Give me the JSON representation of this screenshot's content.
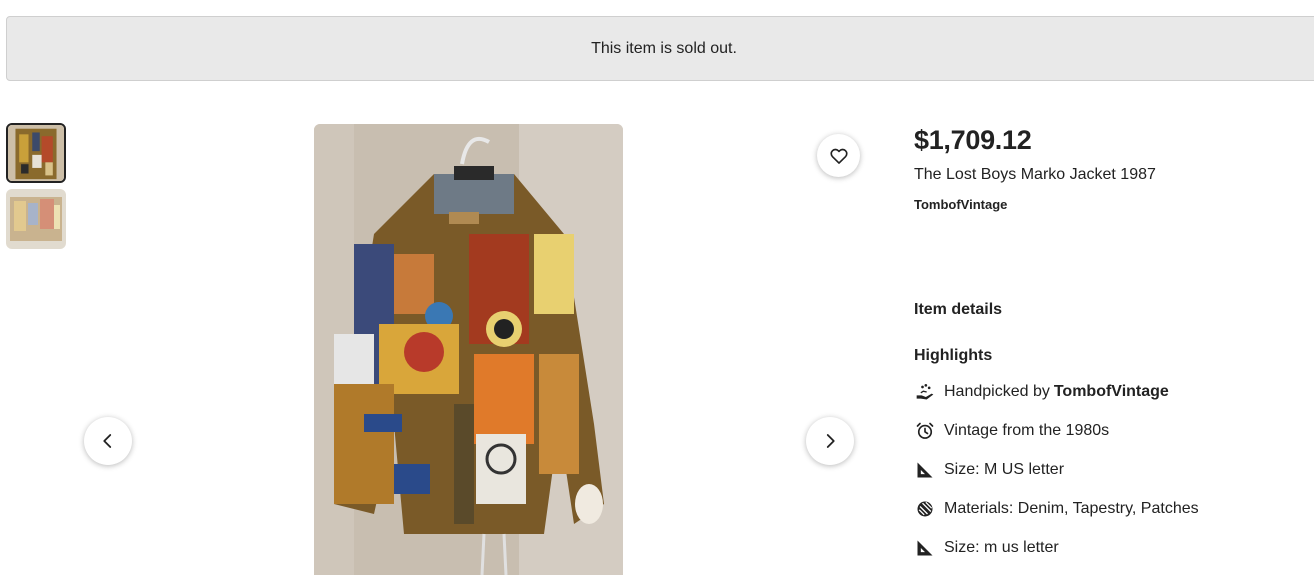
{
  "banner": {
    "text": "This item is sold out."
  },
  "gallery": {
    "thumbnails": [
      "thumbnail-1",
      "thumbnail-2"
    ],
    "selected_index": 0
  },
  "listing": {
    "price": "$1,709.12",
    "title": "The Lost Boys Marko Jacket 1987",
    "shop_name": "TombofVintage"
  },
  "details": {
    "heading": "Item details",
    "highlights_heading": "Highlights",
    "highlights": [
      {
        "icon": "hand-picked-icon",
        "prefix": "Handpicked by",
        "bold": "TombofVintage"
      },
      {
        "icon": "alarm-clock-icon",
        "text": "Vintage from the 1980s"
      },
      {
        "icon": "ruler-triangle-icon",
        "text": "Size: M US letter"
      },
      {
        "icon": "materials-icon",
        "text": "Materials: Denim, Tapestry, Patches"
      },
      {
        "icon": "ruler-triangle-icon",
        "text": "Size: m us letter"
      }
    ]
  },
  "colors": {
    "banner_bg": "#e9e9e9",
    "text": "#222222"
  }
}
